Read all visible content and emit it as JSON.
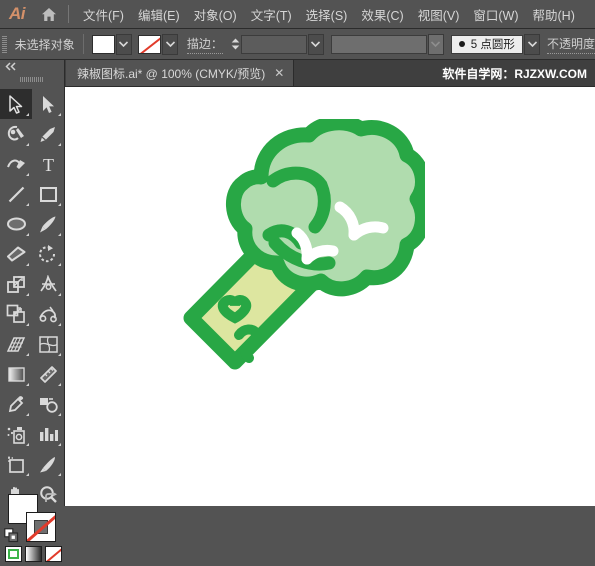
{
  "app": {
    "name": "Ai",
    "logo_label": "Ai",
    "home_icon": "home-icon"
  },
  "menubar": {
    "items": [
      {
        "label": "文件(F)"
      },
      {
        "label": "编辑(E)"
      },
      {
        "label": "对象(O)"
      },
      {
        "label": "文字(T)"
      },
      {
        "label": "选择(S)"
      },
      {
        "label": "效果(C)"
      },
      {
        "label": "视图(V)"
      },
      {
        "label": "窗口(W)"
      },
      {
        "label": "帮助(H)"
      }
    ]
  },
  "controlbar": {
    "selection_status": "未选择对象",
    "fill_swatch": "#ffffff",
    "stroke_swatch_none": true,
    "stroke_label": "描边：",
    "stroke_weight_value": "",
    "style_field_value": "",
    "brush_label": "5 点圆形",
    "opacity_label": "不透明度"
  },
  "tabbar": {
    "document_tab": "辣椒图标.ai* @ 100% (CMYK/预览)",
    "close_label": "✕",
    "watermark": "软件自学网：RJZXW.COM"
  },
  "toolbar": {
    "collapse_label": "◂◂",
    "tools": [
      {
        "name": "selection-tool",
        "label": "选择工具",
        "active": true
      },
      {
        "name": "direct-selection-tool",
        "label": "直接选择工具",
        "active": false
      },
      {
        "name": "magic-wand-tool",
        "label": "魔棒工具",
        "active": false
      },
      {
        "name": "pen-tool",
        "label": "钢笔工具",
        "active": false
      },
      {
        "name": "curvature-tool",
        "label": "曲率工具",
        "active": false
      },
      {
        "name": "type-tool",
        "label": "文字工具",
        "active": false
      },
      {
        "name": "line-segment-tool",
        "label": "直线段工具",
        "active": false
      },
      {
        "name": "rectangle-tool",
        "label": "矩形工具",
        "active": false
      },
      {
        "name": "ellipse-tool",
        "label": "椭圆工具",
        "active": false
      },
      {
        "name": "paintbrush-tool",
        "label": "画笔工具",
        "active": false
      },
      {
        "name": "eraser-tool",
        "label": "橡皮擦工具",
        "active": false
      },
      {
        "name": "rotate-tool",
        "label": "旋转工具",
        "active": false
      },
      {
        "name": "scale-tool",
        "label": "比例缩放工具",
        "active": false
      },
      {
        "name": "width-tool",
        "label": "宽度工具",
        "active": false
      },
      {
        "name": "free-transform-tool",
        "label": "自由变换工具",
        "active": false
      },
      {
        "name": "shape-builder-tool",
        "label": "形状生成器工具",
        "active": false
      },
      {
        "name": "perspective-grid-tool",
        "label": "透视网格工具",
        "active": false
      },
      {
        "name": "mesh-tool",
        "label": "网格工具",
        "active": false
      },
      {
        "name": "gradient-tool",
        "label": "渐变工具",
        "active": false
      },
      {
        "name": "measure-tool",
        "label": "度量工具",
        "active": false
      },
      {
        "name": "eyedropper-tool",
        "label": "吸管工具",
        "active": false
      },
      {
        "name": "blend-tool",
        "label": "混合工具",
        "active": false
      },
      {
        "name": "symbol-sprayer-tool",
        "label": "符号喷枪工具",
        "active": false
      },
      {
        "name": "column-graph-tool",
        "label": "柱形图工具",
        "active": false
      },
      {
        "name": "artboard-tool",
        "label": "画板工具",
        "active": false
      },
      {
        "name": "slice-tool",
        "label": "切片工具",
        "active": false
      },
      {
        "name": "hand-tool",
        "label": "抓手工具",
        "active": false
      },
      {
        "name": "zoom-tool",
        "label": "缩放工具",
        "active": false
      }
    ],
    "fill_color": "#ffffff",
    "stroke_color": "none",
    "swap_icon": "swap-fill-stroke-icon",
    "default_icon": "default-fill-stroke-icon",
    "modes": [
      {
        "name": "color-mode-button",
        "label": "颜色"
      },
      {
        "name": "gradient-mode-button",
        "label": "渐变"
      },
      {
        "name": "none-mode-button",
        "label": "无"
      }
    ]
  },
  "canvas": {
    "background": "#ffffff",
    "artwork_name": "broccoli-icon",
    "colors": {
      "outline_green": "#28a745",
      "floret_fill": "#b0dcae",
      "stem_fill": "#dde6a0",
      "highlight": "#ffffff"
    }
  }
}
